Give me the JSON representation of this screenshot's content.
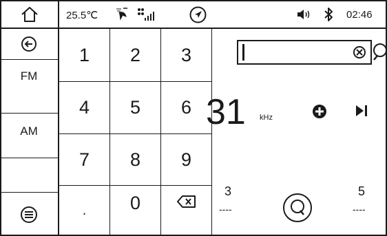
{
  "status_bar": {
    "temperature": "25.5℃",
    "time": "02:46"
  },
  "sidebar": {
    "fm_label": "FM",
    "am_label": "AM"
  },
  "keypad": {
    "keys": [
      "1",
      "2",
      "3",
      "4",
      "5",
      "6",
      "7",
      "8",
      "9",
      ".",
      "0"
    ]
  },
  "tuner": {
    "search_value": "",
    "frequency": "31",
    "unit": "kHz"
  },
  "presets": [
    {
      "number": "3",
      "name": "----"
    },
    {
      "number": "5",
      "name": "----"
    }
  ]
}
